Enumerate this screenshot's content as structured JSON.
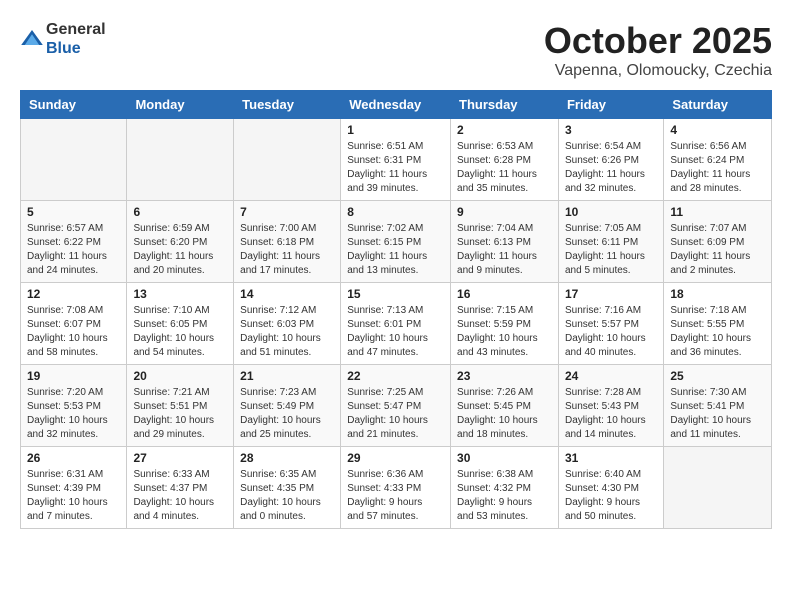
{
  "header": {
    "logo": {
      "general": "General",
      "blue": "Blue"
    },
    "title": "October 2025",
    "location": "Vapenna, Olomoucky, Czechia"
  },
  "weekdays": [
    "Sunday",
    "Monday",
    "Tuesday",
    "Wednesday",
    "Thursday",
    "Friday",
    "Saturday"
  ],
  "weeks": [
    [
      {
        "day": "",
        "info": ""
      },
      {
        "day": "",
        "info": ""
      },
      {
        "day": "",
        "info": ""
      },
      {
        "day": "1",
        "info": "Sunrise: 6:51 AM\nSunset: 6:31 PM\nDaylight: 11 hours\nand 39 minutes."
      },
      {
        "day": "2",
        "info": "Sunrise: 6:53 AM\nSunset: 6:28 PM\nDaylight: 11 hours\nand 35 minutes."
      },
      {
        "day": "3",
        "info": "Sunrise: 6:54 AM\nSunset: 6:26 PM\nDaylight: 11 hours\nand 32 minutes."
      },
      {
        "day": "4",
        "info": "Sunrise: 6:56 AM\nSunset: 6:24 PM\nDaylight: 11 hours\nand 28 minutes."
      }
    ],
    [
      {
        "day": "5",
        "info": "Sunrise: 6:57 AM\nSunset: 6:22 PM\nDaylight: 11 hours\nand 24 minutes."
      },
      {
        "day": "6",
        "info": "Sunrise: 6:59 AM\nSunset: 6:20 PM\nDaylight: 11 hours\nand 20 minutes."
      },
      {
        "day": "7",
        "info": "Sunrise: 7:00 AM\nSunset: 6:18 PM\nDaylight: 11 hours\nand 17 minutes."
      },
      {
        "day": "8",
        "info": "Sunrise: 7:02 AM\nSunset: 6:15 PM\nDaylight: 11 hours\nand 13 minutes."
      },
      {
        "day": "9",
        "info": "Sunrise: 7:04 AM\nSunset: 6:13 PM\nDaylight: 11 hours\nand 9 minutes."
      },
      {
        "day": "10",
        "info": "Sunrise: 7:05 AM\nSunset: 6:11 PM\nDaylight: 11 hours\nand 5 minutes."
      },
      {
        "day": "11",
        "info": "Sunrise: 7:07 AM\nSunset: 6:09 PM\nDaylight: 11 hours\nand 2 minutes."
      }
    ],
    [
      {
        "day": "12",
        "info": "Sunrise: 7:08 AM\nSunset: 6:07 PM\nDaylight: 10 hours\nand 58 minutes."
      },
      {
        "day": "13",
        "info": "Sunrise: 7:10 AM\nSunset: 6:05 PM\nDaylight: 10 hours\nand 54 minutes."
      },
      {
        "day": "14",
        "info": "Sunrise: 7:12 AM\nSunset: 6:03 PM\nDaylight: 10 hours\nand 51 minutes."
      },
      {
        "day": "15",
        "info": "Sunrise: 7:13 AM\nSunset: 6:01 PM\nDaylight: 10 hours\nand 47 minutes."
      },
      {
        "day": "16",
        "info": "Sunrise: 7:15 AM\nSunset: 5:59 PM\nDaylight: 10 hours\nand 43 minutes."
      },
      {
        "day": "17",
        "info": "Sunrise: 7:16 AM\nSunset: 5:57 PM\nDaylight: 10 hours\nand 40 minutes."
      },
      {
        "day": "18",
        "info": "Sunrise: 7:18 AM\nSunset: 5:55 PM\nDaylight: 10 hours\nand 36 minutes."
      }
    ],
    [
      {
        "day": "19",
        "info": "Sunrise: 7:20 AM\nSunset: 5:53 PM\nDaylight: 10 hours\nand 32 minutes."
      },
      {
        "day": "20",
        "info": "Sunrise: 7:21 AM\nSunset: 5:51 PM\nDaylight: 10 hours\nand 29 minutes."
      },
      {
        "day": "21",
        "info": "Sunrise: 7:23 AM\nSunset: 5:49 PM\nDaylight: 10 hours\nand 25 minutes."
      },
      {
        "day": "22",
        "info": "Sunrise: 7:25 AM\nSunset: 5:47 PM\nDaylight: 10 hours\nand 21 minutes."
      },
      {
        "day": "23",
        "info": "Sunrise: 7:26 AM\nSunset: 5:45 PM\nDaylight: 10 hours\nand 18 minutes."
      },
      {
        "day": "24",
        "info": "Sunrise: 7:28 AM\nSunset: 5:43 PM\nDaylight: 10 hours\nand 14 minutes."
      },
      {
        "day": "25",
        "info": "Sunrise: 7:30 AM\nSunset: 5:41 PM\nDaylight: 10 hours\nand 11 minutes."
      }
    ],
    [
      {
        "day": "26",
        "info": "Sunrise: 6:31 AM\nSunset: 4:39 PM\nDaylight: 10 hours\nand 7 minutes."
      },
      {
        "day": "27",
        "info": "Sunrise: 6:33 AM\nSunset: 4:37 PM\nDaylight: 10 hours\nand 4 minutes."
      },
      {
        "day": "28",
        "info": "Sunrise: 6:35 AM\nSunset: 4:35 PM\nDaylight: 10 hours\nand 0 minutes."
      },
      {
        "day": "29",
        "info": "Sunrise: 6:36 AM\nSunset: 4:33 PM\nDaylight: 9 hours\nand 57 minutes."
      },
      {
        "day": "30",
        "info": "Sunrise: 6:38 AM\nSunset: 4:32 PM\nDaylight: 9 hours\nand 53 minutes."
      },
      {
        "day": "31",
        "info": "Sunrise: 6:40 AM\nSunset: 4:30 PM\nDaylight: 9 hours\nand 50 minutes."
      },
      {
        "day": "",
        "info": ""
      }
    ]
  ]
}
